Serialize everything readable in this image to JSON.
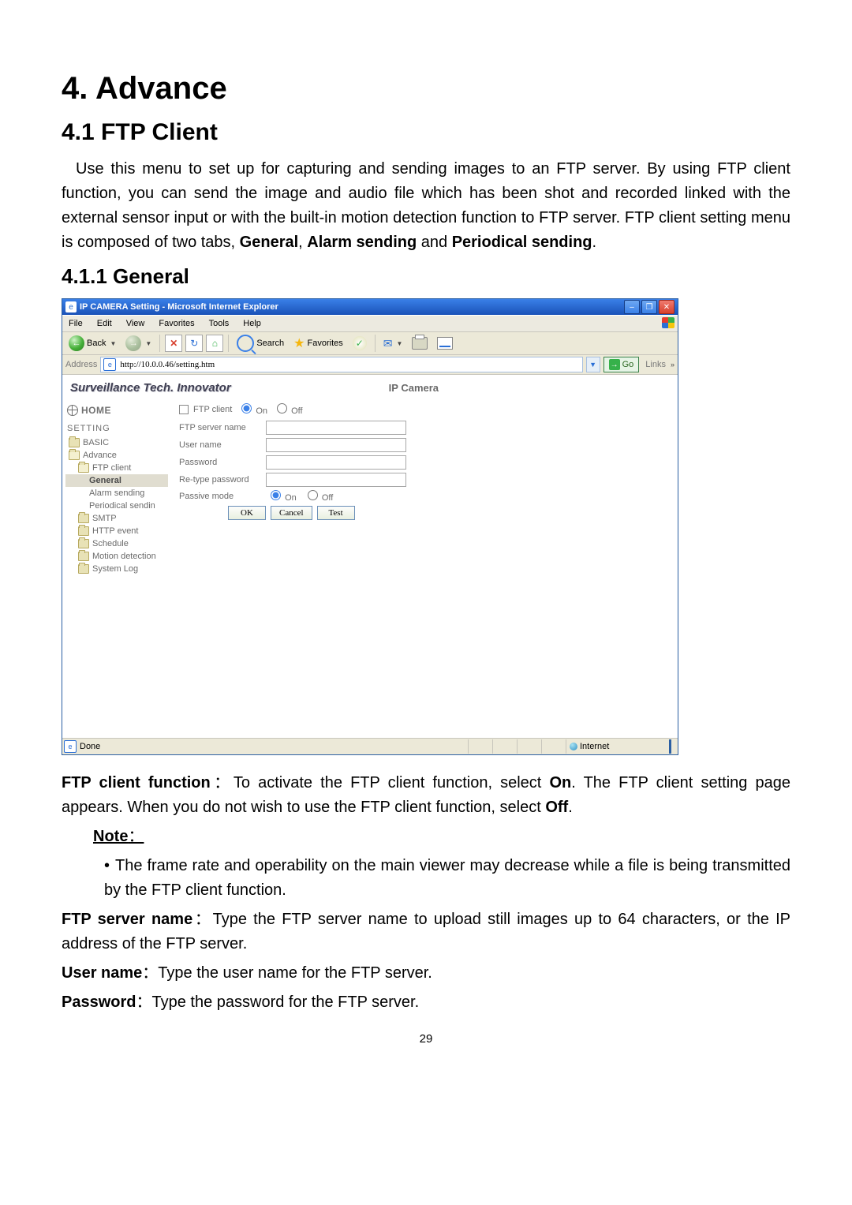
{
  "doc": {
    "h1": "4. Advance",
    "h2": "4.1 FTP Client",
    "intro_plain_1": "Use this menu to set up for capturing and sending images to an FTP server. By using FTP client function, you can send the image and audio file which has been shot and recorded linked with the external sensor input or with the built-in motion detection function to FTP server. FTP client setting menu is composed of two tabs, ",
    "intro_b1": "General",
    "intro_sep1": ", ",
    "intro_b2": "Alarm sending",
    "intro_sep2": " and ",
    "intro_b3": "Periodical sending",
    "intro_tail": ".",
    "h3": "4.1.1 General",
    "ftp_func_b": "FTP client function",
    "ftp_func_colon": "：",
    "ftp_func_text_a": "To activate the FTP client function, select ",
    "ftp_func_on": "On",
    "ftp_func_text_b": ". The FTP client setting page appears. When you do not wish to use the FTP client function, select ",
    "ftp_func_off": "Off",
    "note_b": "Note",
    "note_colon": "：",
    "note_bullet": "The frame rate and operability on the main viewer may decrease while a file is being transmitted by the FTP client function.",
    "srv_b": "FTP server name",
    "srv_colon": "：",
    "srv_text": "Type the FTP server name to upload still images up to 64 characters, or the IP address of the FTP server.",
    "usr_b": "User name",
    "usr_colon": "：",
    "usr_text": "Type the user name for the FTP server.",
    "pwd_b": "Password",
    "pwd_colon": "：",
    "pwd_text": "Type the password for the FTP server.",
    "pagenum": "29"
  },
  "ie": {
    "title": "IP CAMERA Setting - Microsoft Internet Explorer",
    "menus": [
      "File",
      "Edit",
      "View",
      "Favorites",
      "Tools",
      "Help"
    ],
    "back": "Back",
    "search": "Search",
    "favorites": "Favorites",
    "address_label": "Address",
    "address_value": "http://10.0.0.46/setting.htm",
    "go": "Go",
    "links": "Links",
    "status_done": "Done",
    "zone": "Internet"
  },
  "cam": {
    "brand": "Surveillance Tech. Innovator",
    "model": "IP Camera",
    "home": "HOME",
    "setting": "SETTING",
    "nav": {
      "basic": "BASIC",
      "advance": "Advance",
      "ftpclient": "FTP client",
      "general": "General",
      "alarm": "Alarm sending",
      "periodical": "Periodical sendin",
      "smtp": "SMTP",
      "httpevent": "HTTP event",
      "schedule": "Schedule",
      "motion": "Motion detection",
      "syslog": "System Log"
    },
    "form": {
      "clientlabel": "FTP client",
      "on": "On",
      "off": "Off",
      "server": "FTP server name",
      "user": "User name",
      "pass": "Password",
      "repass": "Re-type password",
      "passive": "Passive mode",
      "ok": "OK",
      "cancel": "Cancel",
      "test": "Test"
    }
  }
}
